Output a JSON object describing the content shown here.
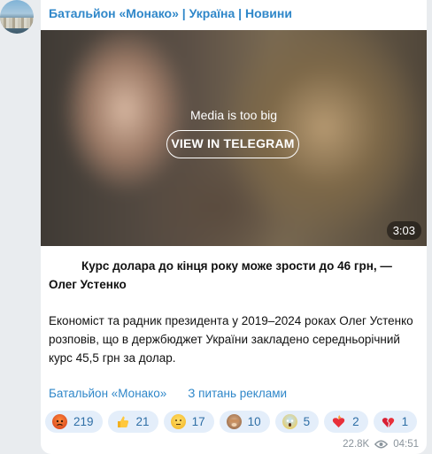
{
  "channel": {
    "name": "Батальйон «Монако» | Україна | Новини"
  },
  "media": {
    "notice": "Media is too big",
    "button_label": "VIEW IN TELEGRAM",
    "duration": "3:03"
  },
  "post": {
    "title": "Курс долара до кінця року може зрости до 46 грн, — Олег Устенко",
    "body": "Економіст та радник президента у 2019–2024 роках Олег Устенко розповів, що в держбюджет України закладено середньорічний курс 45,5 грн за долар.",
    "links": [
      "Батальйон «Монако»",
      "З питань реклами"
    ]
  },
  "reactions": [
    {
      "icon": "angry-face-icon",
      "count": "219"
    },
    {
      "icon": "thumbs-up-icon",
      "count": "21"
    },
    {
      "icon": "thinking-face-icon",
      "count": "17"
    },
    {
      "icon": "see-no-evil-monkey-icon",
      "count": "10"
    },
    {
      "icon": "screaming-face-icon",
      "count": "5"
    },
    {
      "icon": "heart-on-fire-icon",
      "count": "2"
    },
    {
      "icon": "broken-heart-icon",
      "count": "1"
    }
  ],
  "meta": {
    "views": "22.8K",
    "time": "04:51"
  },
  "colors": {
    "link": "#2f87c9",
    "reaction_bg": "#e4eefa",
    "reaction_text": "#2f6fa6",
    "background": "#e9ecef"
  }
}
